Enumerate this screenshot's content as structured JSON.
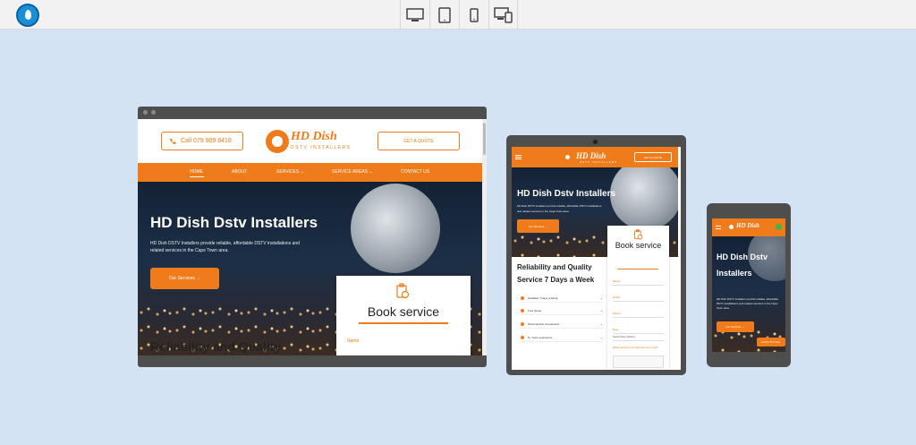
{
  "toolbar": {
    "logo_icon": "app-logo-icon",
    "devices": [
      "desktop-icon",
      "tablet-icon",
      "phone-icon",
      "responsive-icon"
    ]
  },
  "colors": {
    "brand": "#ef7b1a",
    "background": "#d3e3f4",
    "frame": "#4e4e4e"
  },
  "desktop": {
    "phone_label": "Call 079 909 8418",
    "logo_text": "HD Dish",
    "logo_sub": "DSTV INSTALLERS",
    "quote_label": "GET A QUOTE",
    "nav": [
      "HOME",
      "ABOUT",
      "SERVICES ⌄",
      "SERVICE AREAS ⌄",
      "CONTACT US"
    ],
    "hero_title": "HD Dish Dstv Installers",
    "hero_desc": "HD Dish DSTV Installers provide reliable, affordable DSTV installations and related services in the Cape Town area.",
    "hero_button": "Our Services →",
    "book_title": "Book service",
    "book_name_label": "Name",
    "reliability": "Reliability and Quality"
  },
  "tablet": {
    "logo_text": "HD Dish",
    "logo_sub": "DSTV INSTALLERS",
    "quote_label": "GET A QUOTE",
    "hero_title": "HD Dish Dstv Installers",
    "hero_desc": "HD Dish DSTV Installers provide reliable, affordable DSTV installations and related services in the Cape Town area.",
    "hero_button": "Our Services →",
    "book_title": "Book service",
    "fields": [
      "Name",
      "Email",
      "Phone",
      "Date",
      "What service or product do you need?"
    ],
    "date_value": "Select Day Submit",
    "reliability": "Reliability and Quality Service 7 Days a Week",
    "list": [
      "Available 7 Days a Week",
      "Free Quote",
      "Workmanship Guaranteed",
      "5+ Years experience"
    ]
  },
  "phone": {
    "logo_text": "HD Dish",
    "hero_title": "HD Dish Dstv Installers",
    "hero_desc": "HD Dish DSTV Installers provide reliable, affordable DSTV installations and related services in the Cape Town area.",
    "hero_button": "Our Services →",
    "call_button": "CLICK TO CALL"
  }
}
